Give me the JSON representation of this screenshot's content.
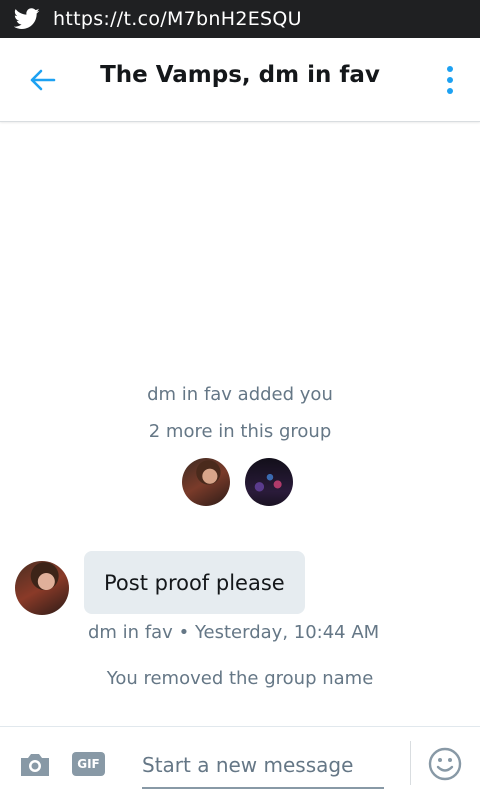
{
  "status_bar": {
    "icon": "twitter-bird-icon",
    "notification_text": "https://t.co/M7bnH2ESQU"
  },
  "header": {
    "back_icon": "arrow-left-icon",
    "title": "The Vamps, dm in fav",
    "more_icon": "more-vertical-icon"
  },
  "conversation": {
    "system_added": "dm in fav added you",
    "system_more": "2 more in this group",
    "group_avatars": [
      "avatar-dm-in-fav",
      "avatar-member-2"
    ],
    "message": {
      "text": "Post proof please",
      "sender": "dm in fav",
      "separator": "•",
      "time": "Yesterday, 10:44 AM"
    },
    "system_removed": "You removed the group name"
  },
  "composer": {
    "camera_icon": "camera-icon",
    "gif_label": "GIF",
    "placeholder": "Start a new message",
    "emoji_icon": "emoji-icon"
  },
  "colors": {
    "accent": "#1da1f2",
    "status_bar": "#1f2022",
    "bubble": "#e6ecf0",
    "muted_text": "#657786"
  }
}
